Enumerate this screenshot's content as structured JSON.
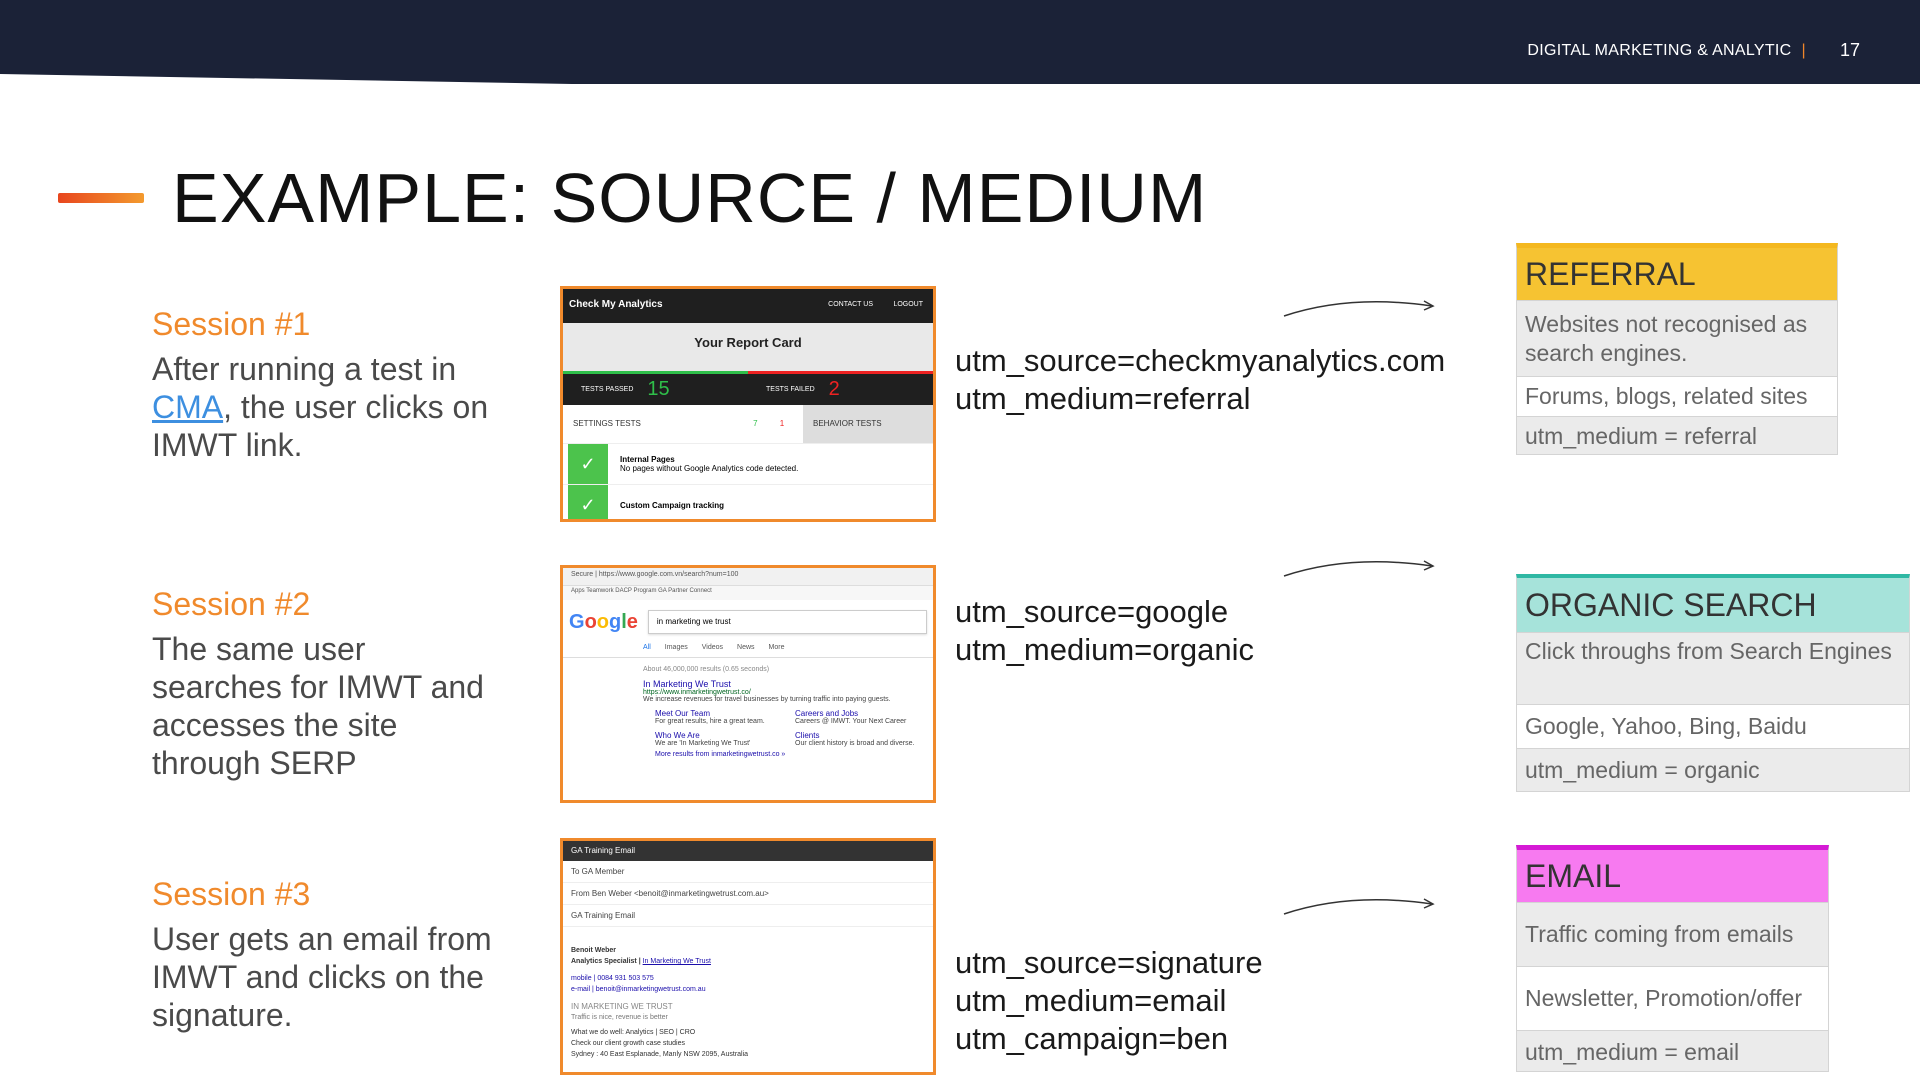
{
  "header": {
    "brand": "DIGITAL MARKETING & ANALYTIC",
    "separator": "|",
    "page_number": "17"
  },
  "title": "EXAMPLE: SOURCE / MEDIUM",
  "sessions": [
    {
      "title": "Session #1",
      "desc_before": "After running a test in ",
      "desc_link": "CMA",
      "desc_after": ", the user clicks on IMWT link."
    },
    {
      "title": "Session #2",
      "desc": "The same user searches for  IMWT and accesses the site through SERP"
    },
    {
      "title": "Session #3",
      "desc": "User gets an email from IMWT and clicks on the signature."
    }
  ],
  "screenshot1": {
    "brand": "Check My Analytics",
    "nav_contact": "CONTACT US",
    "nav_logout": "LOGOUT",
    "report_title": "Your Report Card",
    "passed_label": "TESTS PASSED",
    "passed_value": "15",
    "failed_label": "TESTS FAILED",
    "failed_value": "2",
    "tab_settings": "SETTINGS TESTS",
    "tab_settings_pass": "7",
    "tab_settings_fail": "1",
    "tab_behavior": "BEHAVIOR TESTS",
    "row1_title": "Internal Pages",
    "row1_desc": "No pages without Google Analytics code detected.",
    "row2_title": "Custom Campaign tracking"
  },
  "screenshot2": {
    "url": "Secure | https://www.google.com.vn/search?num=100",
    "bookmarks": "Apps   Teamwork   DACP Program   GA Partner Connect",
    "logo": "Google",
    "query": "in marketing we trust",
    "tabs": [
      "All",
      "Images",
      "Videos",
      "News",
      "More"
    ],
    "stats": "About 46,000,000 results (0.65 seconds)",
    "result_title": "In Marketing We Trust",
    "result_url": "https://www.inmarketingwetrust.co/",
    "result_desc": "We increase revenues for travel businesses by turning traffic into paying guests.",
    "sitelinks": [
      {
        "title": "Meet Our Team",
        "desc": "For great results, hire a great team."
      },
      {
        "title": "Careers and Jobs",
        "desc": "Careers @ IMWT. Your Next Career"
      },
      {
        "title": "Who We Are",
        "desc": "We are 'In Marketing We Trust'"
      },
      {
        "title": "Clients",
        "desc": "Our client history is broad and diverse."
      }
    ],
    "more": "More results from inmarketingwetrust.co »"
  },
  "screenshot3": {
    "header": "GA Training Email",
    "to": "To    GA Member",
    "from": "From   Ben Weber <benoit@inmarketingwetrust.com.au>",
    "subject": "GA Training Email",
    "sig_name": "Benoit Weber",
    "sig_role": "Analytics Specialist | ",
    "sig_company": "In Marketing We Trust",
    "sig_mobile": "mobile | 0084 931 503 575",
    "sig_email": "e-mail | benoit@inmarketingwetrust.com.au",
    "sig_logo": "IN MARKETING WE TRUST",
    "sig_tagline": "Traffic is nice, revenue is better",
    "sig_do": "What we do well: Analytics | SEO | CRO",
    "sig_check": "Check our client growth case studies",
    "sig_address": "Sydney : 40 East Esplanade, Manly NSW 2095, Australia"
  },
  "utm_blocks": [
    [
      "utm_source=checkmyanalytics.com",
      "utm_medium=referral"
    ],
    [
      "utm_source=google",
      "utm_medium=organic"
    ],
    [
      "utm_source=signature",
      "utm_medium=email",
      "utm_campaign=ben"
    ]
  ],
  "cards": {
    "referral": {
      "title": "REFERRAL",
      "rows": [
        "Websites not recognised as search engines.",
        "Forums, blogs, related sites",
        "utm_medium = referral"
      ],
      "color": "#f6c332"
    },
    "organic": {
      "title": "ORGANIC SEARCH",
      "rows": [
        "Click throughs from Search Engines",
        "Google, Yahoo, Bing, Baidu",
        "utm_medium = organic"
      ],
      "color": "#a6e3da"
    },
    "email": {
      "title": "EMAIL",
      "rows": [
        "Traffic  coming from emails",
        "Newsletter, Promotion/offer",
        "utm_medium = email"
      ],
      "color": "#f77af0"
    }
  },
  "colors": {
    "accent_orange": "#f08a2c",
    "navy": "#1b2237",
    "link_blue": "#3d8fe0"
  }
}
